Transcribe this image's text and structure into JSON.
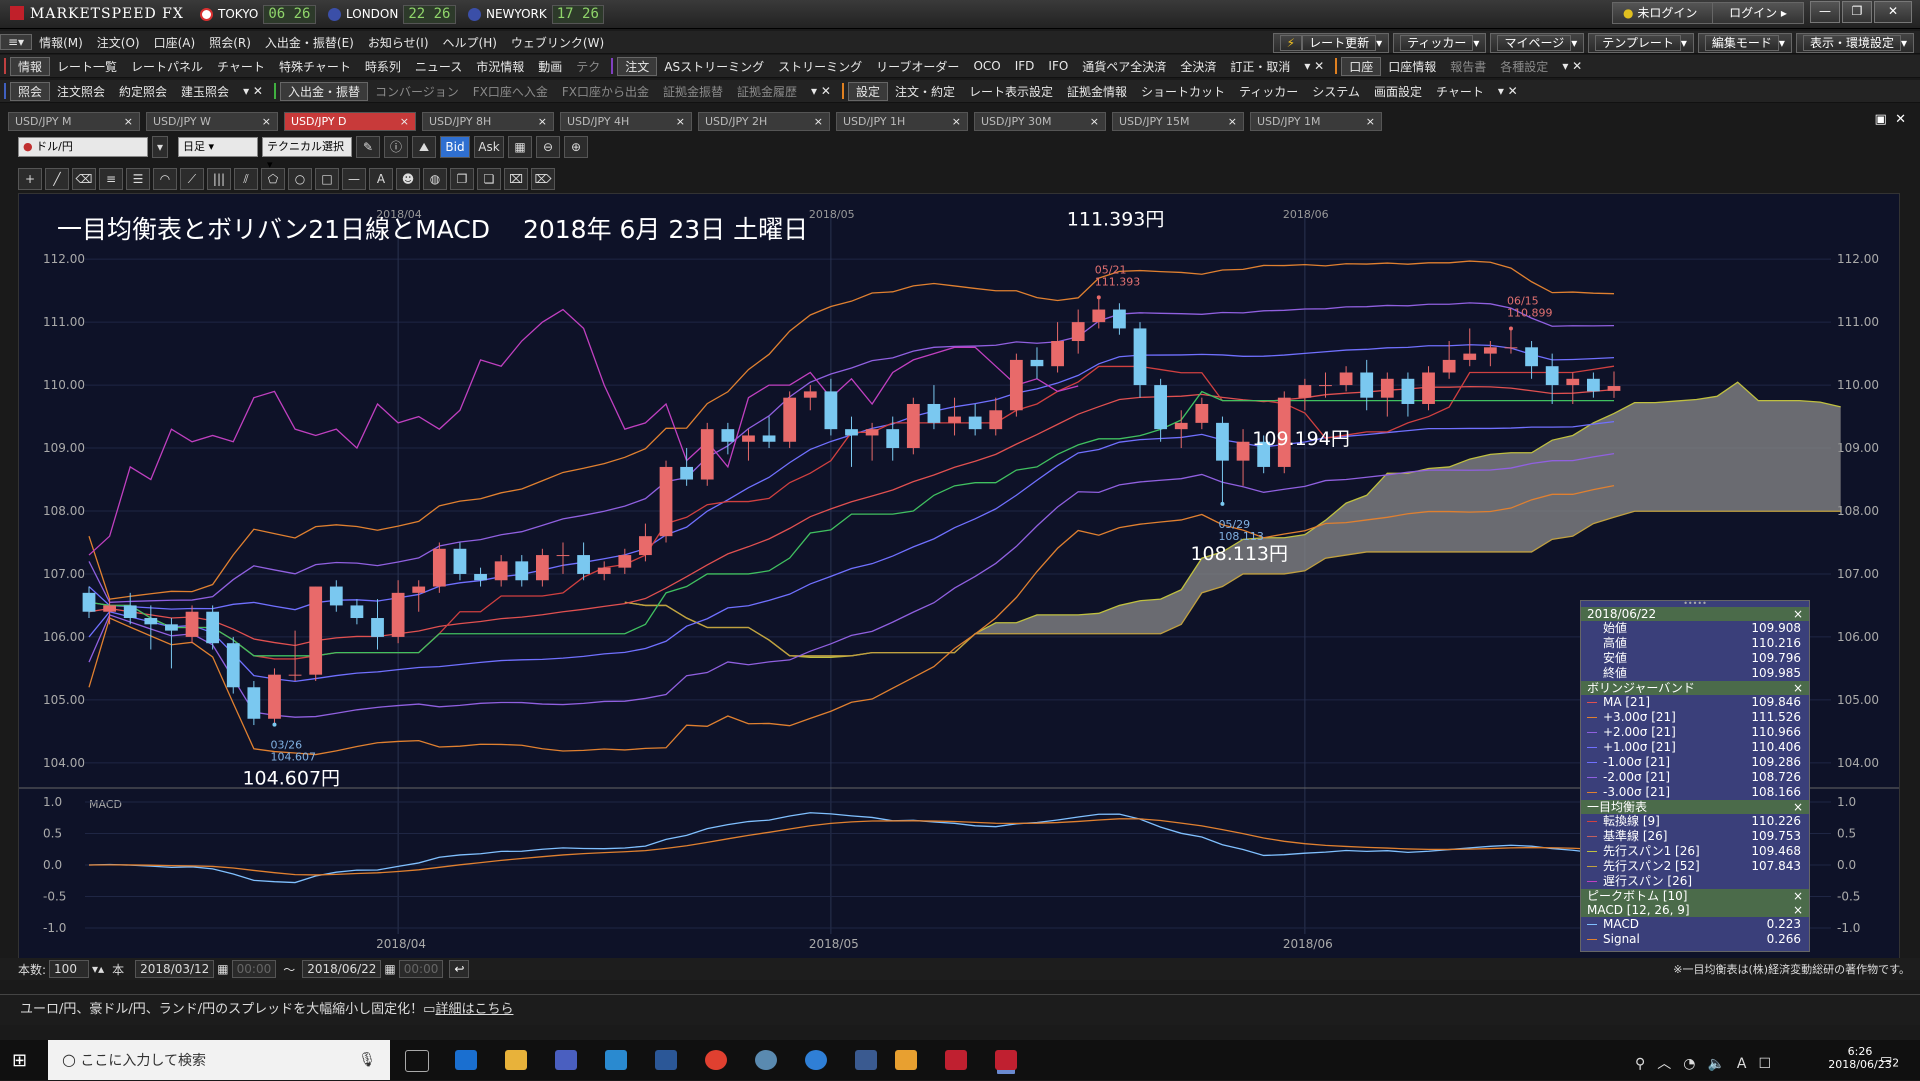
{
  "app": {
    "name": "MARKETSPEED FX",
    "login_status": "未ログイン",
    "login_button": "ログイン"
  },
  "clocks": [
    {
      "city": "TOKYO",
      "time": "06 26",
      "color": "#d93030"
    },
    {
      "city": "LONDON",
      "time": "22 26",
      "color": "#3b4fa8"
    },
    {
      "city": "NEWYORK",
      "time": "17 26",
      "color": "#3b4fa8"
    }
  ],
  "menu": [
    "情報(M)",
    "注文(O)",
    "口座(A)",
    "照会(R)",
    "入出金・振替(E)",
    "お知らせ(I)",
    "ヘルプ(H)",
    "ウェブリンク(W)"
  ],
  "right_tools": [
    "レート更新",
    "ティッカー",
    "マイページ",
    "テンプレート",
    "編集モード",
    "表示・環境設定"
  ],
  "toolbar1": {
    "group1_title": "情報",
    "group1": [
      "レート一覧",
      "レートパネル",
      "チャート",
      "特殊チャート",
      "時系列",
      "ニュース",
      "市況情報",
      "動画",
      "テク"
    ],
    "group2_title": "注文",
    "group2": [
      "ASストリーミング",
      "ストリーミング",
      "リーブオーダー",
      "OCO",
      "IFD",
      "IFO",
      "通貨ペア全決済",
      "全決済",
      "訂正・取消"
    ],
    "group3_title": "口座",
    "group3": [
      "口座情報",
      "報告書",
      "各種設定"
    ]
  },
  "toolbar2": {
    "group1_title": "照会",
    "group1": [
      "注文照会",
      "約定照会",
      "建玉照会"
    ],
    "group2_title": "入出金・振替",
    "group2": [
      "コンバージョン",
      "FX口座へ入金",
      "FX口座から出金",
      "証拠金振替",
      "証拠金履歴"
    ],
    "group3_title": "設定",
    "group3": [
      "注文・約定",
      "レート表示設定",
      "証拠金情報",
      "ショートカット",
      "ティッカー",
      "システム",
      "画面設定",
      "チャート"
    ]
  },
  "tabs": [
    "USD/JPY M",
    "USD/JPY W",
    "USD/JPY D",
    "USD/JPY 8H",
    "USD/JPY 4H",
    "USD/JPY 2H",
    "USD/JPY 1H",
    "USD/JPY 30M",
    "USD/JPY 15M",
    "USD/JPY 1M"
  ],
  "active_tab": 2,
  "chart_toolbar": {
    "pair": "ドル/円",
    "period": "日足",
    "tech": "テクニカル選択",
    "bid": "Bid",
    "ask": "Ask"
  },
  "chart_data": {
    "type": "line",
    "title": "一目均衡表とボリバン21日線とMACD　 2018年 6月 23日 土曜日",
    "x_month_labels": [
      "2018/04",
      "2018/05",
      "2018/06"
    ],
    "ylim": [
      103.6,
      112.4
    ],
    "y_ticks": [
      "112.00",
      "111.00",
      "110.00",
      "109.00",
      "108.00",
      "107.00",
      "106.00",
      "105.00",
      "104.00"
    ],
    "macd_ticks": [
      "1.0",
      "0.5",
      "0.0",
      "-0.5",
      "-1.0"
    ],
    "macd_label": "MACD",
    "candles": [
      [
        106.7,
        106.8,
        106.3,
        106.4
      ],
      [
        106.4,
        106.6,
        106.2,
        106.5
      ],
      [
        106.5,
        106.7,
        106.2,
        106.3
      ],
      [
        106.3,
        106.5,
        105.8,
        106.2
      ],
      [
        106.2,
        106.3,
        105.5,
        106.1
      ],
      [
        106.0,
        106.5,
        105.9,
        106.4
      ],
      [
        106.4,
        106.5,
        105.8,
        105.9
      ],
      [
        105.9,
        106.0,
        105.1,
        105.2
      ],
      [
        105.2,
        105.3,
        104.6,
        104.7
      ],
      [
        104.7,
        105.5,
        104.607,
        105.4
      ],
      [
        105.4,
        106.1,
        105.3,
        105.4
      ],
      [
        105.4,
        106.8,
        105.3,
        106.8
      ],
      [
        106.8,
        106.9,
        106.4,
        106.5
      ],
      [
        106.5,
        106.6,
        106.2,
        106.3
      ],
      [
        106.3,
        106.6,
        105.8,
        106.0
      ],
      [
        106.0,
        106.9,
        105.9,
        106.7
      ],
      [
        106.7,
        106.9,
        106.4,
        106.8
      ],
      [
        106.8,
        107.5,
        106.7,
        107.4
      ],
      [
        107.4,
        107.5,
        106.9,
        107.0
      ],
      [
        107.0,
        107.1,
        106.8,
        106.9
      ],
      [
        106.9,
        107.3,
        106.8,
        107.2
      ],
      [
        107.2,
        107.3,
        106.8,
        106.9
      ],
      [
        106.9,
        107.4,
        106.8,
        107.3
      ],
      [
        107.3,
        107.5,
        107.0,
        107.3
      ],
      [
        107.3,
        107.5,
        106.9,
        107.0
      ],
      [
        107.0,
        107.2,
        106.9,
        107.1
      ],
      [
        107.1,
        107.4,
        107.0,
        107.3
      ],
      [
        107.3,
        107.8,
        107.2,
        107.6
      ],
      [
        107.6,
        108.8,
        107.5,
        108.7
      ],
      [
        108.7,
        109.0,
        108.4,
        108.5
      ],
      [
        108.5,
        109.4,
        108.4,
        109.3
      ],
      [
        109.3,
        109.4,
        108.9,
        109.1
      ],
      [
        109.1,
        109.3,
        108.8,
        109.2
      ],
      [
        109.2,
        109.5,
        109.0,
        109.1
      ],
      [
        109.1,
        109.9,
        109.0,
        109.8
      ],
      [
        109.8,
        110.0,
        109.6,
        109.9
      ],
      [
        109.9,
        110.1,
        109.2,
        109.3
      ],
      [
        109.3,
        109.5,
        108.7,
        109.2
      ],
      [
        109.2,
        109.4,
        108.8,
        109.3
      ],
      [
        109.3,
        109.5,
        108.8,
        109.0
      ],
      [
        109.0,
        109.8,
        108.9,
        109.7
      ],
      [
        109.7,
        110.0,
        109.3,
        109.4
      ],
      [
        109.4,
        109.8,
        109.2,
        109.5
      ],
      [
        109.5,
        109.7,
        109.2,
        109.3
      ],
      [
        109.3,
        109.8,
        109.2,
        109.6
      ],
      [
        109.6,
        110.5,
        109.5,
        110.4
      ],
      [
        110.4,
        110.6,
        110.1,
        110.3
      ],
      [
        110.3,
        111.0,
        110.2,
        110.7
      ],
      [
        110.7,
        111.2,
        110.5,
        111.0
      ],
      [
        111.0,
        111.393,
        110.9,
        111.2
      ],
      [
        111.2,
        111.3,
        110.8,
        110.9
      ],
      [
        110.9,
        111.0,
        109.8,
        110.0
      ],
      [
        110.0,
        110.1,
        109.1,
        109.3
      ],
      [
        109.3,
        109.6,
        109.0,
        109.4
      ],
      [
        109.4,
        109.8,
        109.3,
        109.7
      ],
      [
        109.4,
        109.5,
        108.113,
        108.8
      ],
      [
        108.8,
        109.3,
        108.4,
        109.1
      ],
      [
        109.1,
        109.2,
        108.6,
        108.7
      ],
      [
        108.7,
        109.9,
        108.6,
        109.8
      ],
      [
        109.8,
        110.1,
        109.6,
        110.0
      ],
      [
        110.0,
        110.2,
        109.8,
        110.0
      ],
      [
        110.0,
        110.3,
        109.9,
        110.2
      ],
      [
        110.2,
        110.4,
        109.6,
        109.8
      ],
      [
        109.8,
        110.2,
        109.5,
        110.1
      ],
      [
        110.1,
        110.2,
        109.5,
        109.7
      ],
      [
        109.7,
        110.3,
        109.6,
        110.2
      ],
      [
        110.2,
        110.7,
        110.1,
        110.4
      ],
      [
        110.4,
        110.9,
        110.3,
        110.5
      ],
      [
        110.5,
        110.7,
        110.3,
        110.6
      ],
      [
        110.6,
        110.899,
        110.5,
        110.6
      ],
      [
        110.6,
        110.7,
        110.1,
        110.3
      ],
      [
        110.3,
        110.5,
        109.7,
        110.0
      ],
      [
        110.0,
        110.2,
        109.7,
        110.1
      ],
      [
        110.1,
        110.2,
        109.8,
        109.9
      ],
      [
        109.908,
        110.216,
        109.796,
        109.985
      ]
    ],
    "annotations": [
      {
        "label": "111.393円",
        "date": "05/21",
        "value": "111.393",
        "index": 49,
        "price": 111.393
      },
      {
        "label": "109.194円",
        "index": 58,
        "price": 109.194
      },
      {
        "label": "108.113円",
        "date": "05/29",
        "value": "108.113",
        "index": 55,
        "price": 108.113
      },
      {
        "label": "104.607円",
        "date": "03/26",
        "value": "104.607",
        "index": 9,
        "price": 104.607
      },
      {
        "date": "06/15",
        "value": "110.899",
        "index": 69,
        "price": 110.899
      }
    ]
  },
  "info_panel": {
    "date": "2018/06/22",
    "ohlc": [
      [
        "始値",
        "109.908"
      ],
      [
        "高値",
        "110.216"
      ],
      [
        "安値",
        "109.796"
      ],
      [
        "終値",
        "109.985"
      ]
    ],
    "bb_title": "ボリンジャーバンド",
    "bb": [
      [
        "MA [21]",
        "109.846",
        "#e05050"
      ],
      [
        "+3.00σ [21]",
        "111.526",
        "#e08030"
      ],
      [
        "+2.00σ [21]",
        "110.966",
        "#9060e0"
      ],
      [
        "+1.00σ [21]",
        "110.406",
        "#7070ff"
      ],
      [
        "-1.00σ [21]",
        "109.286",
        "#7070ff"
      ],
      [
        "-2.00σ [21]",
        "108.726",
        "#9060e0"
      ],
      [
        "-3.00σ [21]",
        "108.166",
        "#e08030"
      ]
    ],
    "ichi_title": "一目均衡表",
    "ichi": [
      [
        "転換線 [9]",
        "110.226",
        "#d04040"
      ],
      [
        "基準線 [26]",
        "109.753",
        "#c06060"
      ],
      [
        "先行スパン1 [26]",
        "109.468",
        "#c0c040"
      ],
      [
        "先行スパン2 [52]",
        "107.843",
        "#c0a040"
      ],
      [
        "遅行スパン [26]",
        "",
        "#c040c0"
      ]
    ],
    "peak_title": "ピークボトム [10]",
    "macd_title": "MACD [12, 26, 9]",
    "macd": [
      [
        "MACD",
        "0.223",
        "#80c0ff"
      ],
      [
        "Signal",
        "0.266",
        "#e08030"
      ]
    ]
  },
  "bottom": {
    "count_label": "本数:",
    "count": "100",
    "unit": "本",
    "from": "2018/03/12",
    "to": "2018/06/22",
    "time_from": "00:00",
    "time_to": "00:00",
    "copyright": "※一目均衡表は(株)経済変動総研の著作物です。"
  },
  "news": {
    "text": "ユーロ/円、豪ドル/円、ランド/円のスプレッドを大幅縮小し固定化！",
    "link": "詳細はこちら"
  },
  "taskbar": {
    "search_placeholder": "ここに入力して検索",
    "time": "6:26",
    "date": "2018/06/23",
    "notif": "2"
  }
}
